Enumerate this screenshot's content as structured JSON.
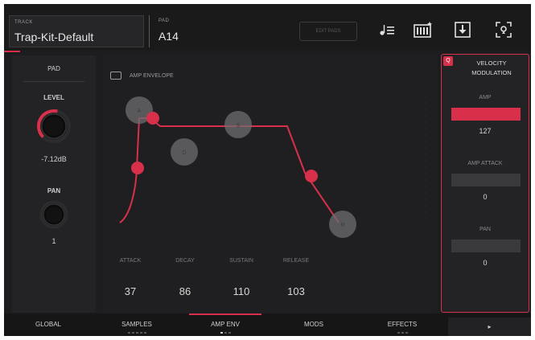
{
  "header": {
    "kit_label": "TRACK",
    "kit_name": "Trap-Kit-Default",
    "pad_label": "PAD",
    "pad_name": "A14",
    "button_label": "EDIT PADS"
  },
  "header_icons": [
    "note-list-icon",
    "pads-grid-icon",
    "download-icon",
    "sample-focus-icon"
  ],
  "left_panel": {
    "title": "PAD",
    "level_label": "LEVEL",
    "level_value": "-7.12dB",
    "level_fraction": 0.55,
    "pan_label": "PAN",
    "pan_value": "1",
    "pan_fraction": 0.5
  },
  "envelope": {
    "title": "AMP ENVELOPE",
    "params": [
      {
        "label": "ATTACK",
        "value": "37"
      },
      {
        "label": "DECAY",
        "value": "86"
      },
      {
        "label": "SUSTAIN",
        "value": "110"
      },
      {
        "label": "RELEASE",
        "value": "103"
      }
    ]
  },
  "velocity_modulation": {
    "badge": "Q",
    "title_line1": "VELOCITY",
    "title_line2": "MODULATION",
    "rows": [
      {
        "label": "AMP",
        "value": "127",
        "fraction": 1.0
      },
      {
        "label": "AMP ATTACK",
        "value": "0",
        "fraction": 0.0
      },
      {
        "label": "PAN",
        "value": "0",
        "fraction": 0.0
      }
    ]
  },
  "tabs": [
    {
      "label": "GLOBAL",
      "active": false
    },
    {
      "label": "SAMPLES",
      "active": false
    },
    {
      "label": "AMP ENV",
      "active": true
    },
    {
      "label": "MODS",
      "active": false
    },
    {
      "label": "EFFECTS",
      "active": false
    }
  ],
  "more_label": "▸",
  "colors": {
    "accent": "#d8304b",
    "background": "#1d1d1f",
    "handle": "#6e6e70"
  }
}
